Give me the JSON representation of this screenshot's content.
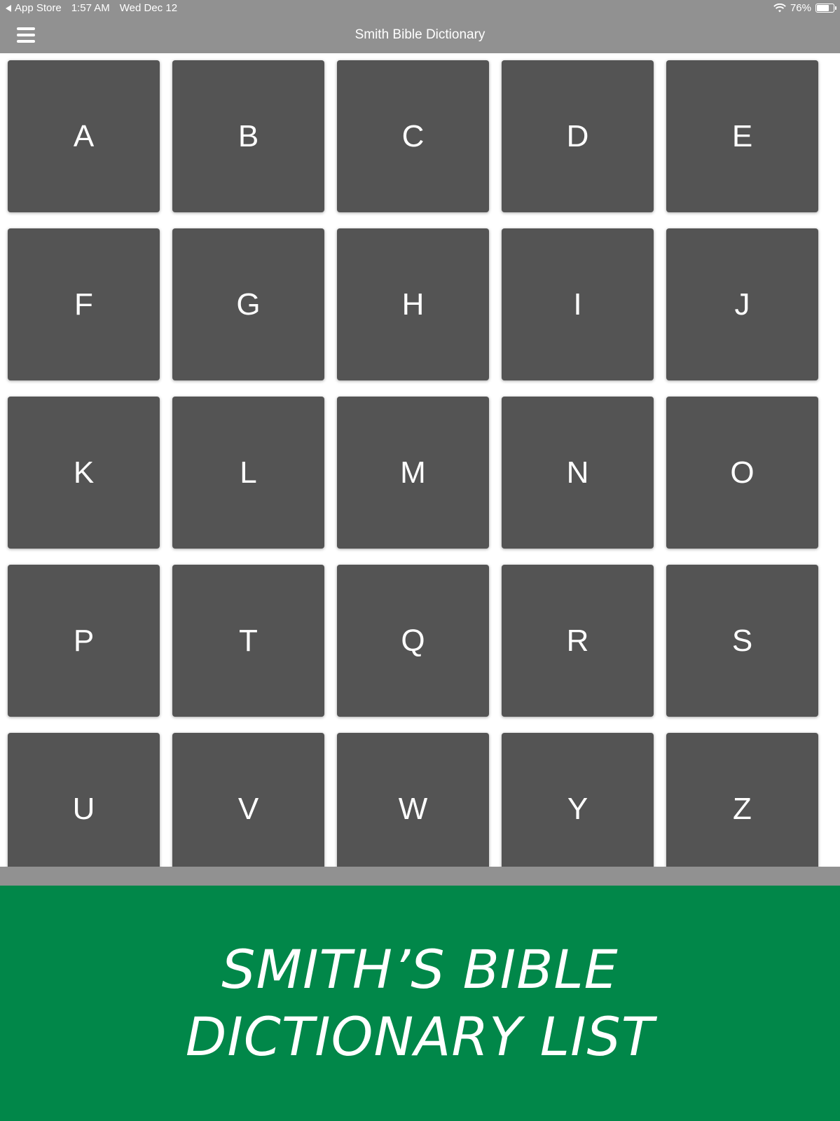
{
  "status_bar": {
    "back_app": "App Store",
    "time": "1:57 AM",
    "date": "Wed Dec 12",
    "battery_percent": "76%",
    "battery_level": 0.76
  },
  "nav": {
    "title": "Smith Bible Dictionary",
    "menu_icon": "hamburger-menu-icon"
  },
  "letters": [
    "A",
    "B",
    "C",
    "D",
    "E",
    "F",
    "G",
    "H",
    "I",
    "J",
    "K",
    "L",
    "M",
    "N",
    "O",
    "P",
    "T",
    "Q",
    "R",
    "S",
    "U",
    "V",
    "W",
    "Y",
    "Z"
  ],
  "banner": {
    "line1": "SMITH’S BIBLE",
    "line2": "DICTIONARY LIST"
  },
  "colors": {
    "bar": "#919191",
    "tile": "#545454",
    "banner": "#018749"
  }
}
